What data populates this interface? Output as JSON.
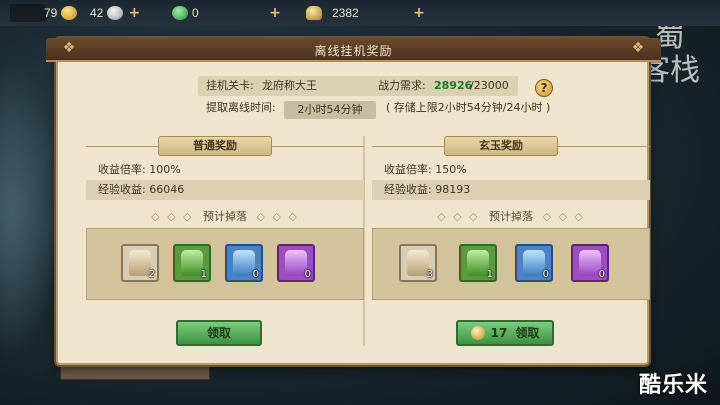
{
  "topbar": {
    "resources": [
      {
        "icon": "gold-ingot-icon",
        "value": "79"
      },
      {
        "icon": "silver-ingot-icon",
        "value": "42"
      },
      {
        "icon": "jade-icon",
        "value": "0"
      },
      {
        "icon": "copper-coin-icon",
        "value": "2382"
      }
    ],
    "plus": "+"
  },
  "bg": {
    "logo": "蜀\n客栈",
    "watermark": "酷乐米"
  },
  "dialog": {
    "title": "离线挂机奖励",
    "stage_label": "挂机关卡:",
    "stage_value": "龙府称大王",
    "power_label": "战力需求:",
    "power_current": "28926",
    "power_required": "/23000",
    "time_label": "提取离线时间:",
    "time_value": "2小时54分钟",
    "storage_note": "( 存储上限2小时54分钟/24小时 )",
    "help": "?"
  },
  "panels": [
    {
      "title": "普通奖励",
      "rate_label": "收益倍率: 100%",
      "exp_label": "经验收益: 66046",
      "drop_title": "预计掉落",
      "items": [
        {
          "quality": "white",
          "count": "2"
        },
        {
          "quality": "green",
          "count": "1"
        },
        {
          "quality": "blue",
          "count": "0"
        },
        {
          "quality": "purple",
          "count": "0"
        }
      ],
      "button": "领取"
    },
    {
      "title": "玄玉奖励",
      "rate_label": "收益倍率: 150%",
      "exp_label": "经验收益: 98193",
      "drop_title": "预计掉落",
      "items": [
        {
          "quality": "white",
          "count": "3"
        },
        {
          "quality": "green",
          "count": "1"
        },
        {
          "quality": "blue",
          "count": "0"
        },
        {
          "quality": "purple",
          "count": "0"
        }
      ],
      "cost": "17",
      "button": "领取"
    }
  ],
  "dots": "◇ ◇ ◇"
}
